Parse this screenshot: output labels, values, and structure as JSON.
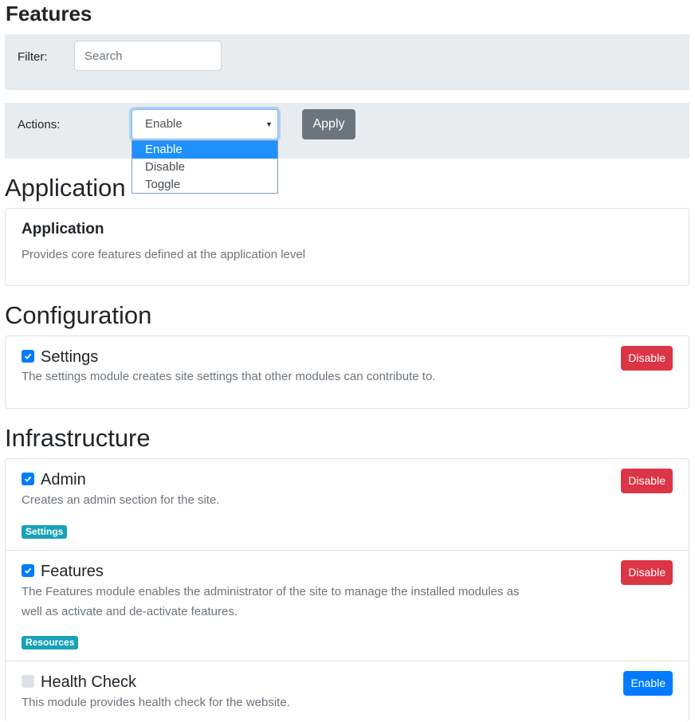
{
  "page": {
    "title": "Features"
  },
  "filter": {
    "label": "Filter:",
    "placeholder": "Search",
    "value": ""
  },
  "actions": {
    "label": "Actions:",
    "selected": "Enable",
    "options": [
      "Enable",
      "Disable",
      "Toggle"
    ],
    "apply_label": "Apply"
  },
  "colors": {
    "danger": "#dc3545",
    "primary": "#007bff",
    "info": "#17a2b8",
    "secondary": "#6c757d"
  },
  "sections": [
    {
      "heading": "Application",
      "items": [
        {
          "title": "Application",
          "description": "Provides core features defined at the application level"
        }
      ]
    },
    {
      "heading": "Configuration",
      "items": [
        {
          "title": "Settings",
          "checked": true,
          "description": "The settings module creates site settings that other modules can contribute to.",
          "button": "Disable"
        }
      ]
    },
    {
      "heading": "Infrastructure",
      "items": [
        {
          "title": "Admin",
          "checked": true,
          "description": "Creates an admin section for the site.",
          "button": "Disable",
          "tag": "Settings"
        },
        {
          "title": "Features",
          "checked": true,
          "description_lines": [
            "The Features module enables the administrator of the site to manage the installed modules as",
            "well as activate and de-activate features."
          ],
          "button": "Disable",
          "tag": "Resources"
        },
        {
          "title": "Health Check",
          "checked": false,
          "description": "This module provides health check for the website.",
          "button": "Enable"
        }
      ]
    }
  ]
}
